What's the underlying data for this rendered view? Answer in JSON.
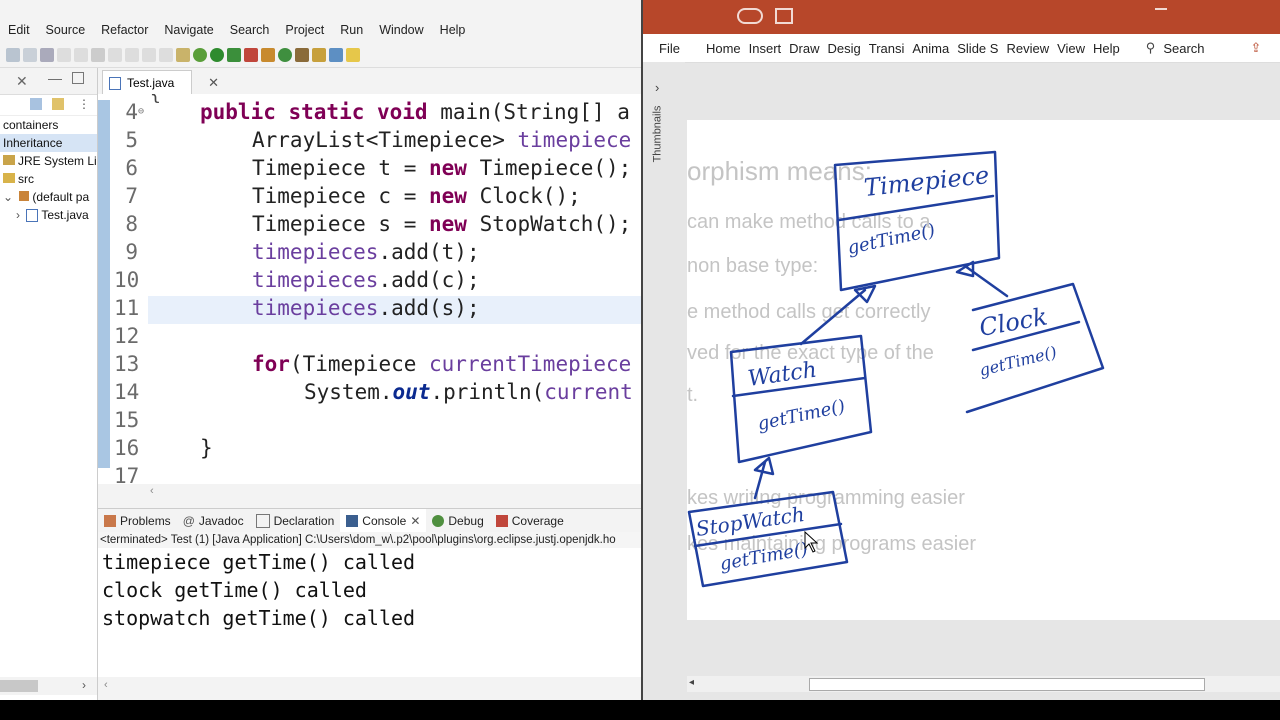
{
  "eclipse": {
    "menu": [
      "Edit",
      "Source",
      "Refactor",
      "Navigate",
      "Search",
      "Project",
      "Run",
      "Window",
      "Help"
    ],
    "package_explorer": {
      "rows": [
        "containers",
        "Inheritance",
        "JRE System Lib",
        "src",
        "(default pa",
        "Test.java"
      ],
      "selected_index": 1
    },
    "editor": {
      "tab_label": "Test.java",
      "lines": [
        {
          "num": "4",
          "text": "public static void main(String[] a"
        },
        {
          "num": "5",
          "text": "ArrayList<Timepiece> timepiece"
        },
        {
          "num": "6",
          "text": "Timepiece t = new Timepiece();"
        },
        {
          "num": "7",
          "text": "Timepiece c = new Clock();"
        },
        {
          "num": "8",
          "text": "Timepiece s = new StopWatch();"
        },
        {
          "num": "9",
          "text": "timepieces.add(t);"
        },
        {
          "num": "10",
          "text": "timepieces.add(c);"
        },
        {
          "num": "11",
          "text": "timepieces.add(s);"
        },
        {
          "num": "12",
          "text": ""
        },
        {
          "num": "13",
          "text": "for(Timepiece currentTimepiece"
        },
        {
          "num": "14",
          "text": "System.out.println(current"
        },
        {
          "num": "15",
          "text": ""
        },
        {
          "num": "16",
          "text": "}"
        },
        {
          "num": "17",
          "text": ""
        }
      ]
    },
    "bottom_tabs": [
      "Problems",
      "Javadoc",
      "Declaration",
      "Console",
      "Debug",
      "Coverage"
    ],
    "console": {
      "status": "<terminated> Test (1) [Java Application] C:\\Users\\dom_w\\.p2\\pool\\plugins\\org.eclipse.justj.openjdk.ho",
      "output": [
        "timepiece getTime() called",
        "clock getTime() called",
        "stopwatch getTime() called"
      ]
    }
  },
  "powerpoint": {
    "tabs": [
      "File",
      "Home",
      "Insert",
      "Draw",
      "Desig",
      "Transi",
      "Anima",
      "Slide S",
      "Review",
      "View",
      "Help"
    ],
    "search_label": "Search",
    "thumbnails_label": "Thumbnails",
    "slide_text": [
      "orphism means:",
      "can make method calls to a",
      "non base type:",
      "e method calls get correctly",
      "ved for the exact type of the",
      "t.",
      "kes writing programming easier",
      "kes maintaining programs easier"
    ],
    "ink_labels": {
      "timepiece": "Timepiece",
      "timepiece_method": "getTime()",
      "watch": "Watch",
      "watch_method": "getTime()",
      "clock": "Clock",
      "clock_method": "getTime()",
      "stopwatch": "StopWatch",
      "stopwatch_method": "getTime()"
    },
    "colors": {
      "ink": "#1f3f9f",
      "title_bar": "#b7472a",
      "faded_text": "#c4c4c4"
    }
  }
}
